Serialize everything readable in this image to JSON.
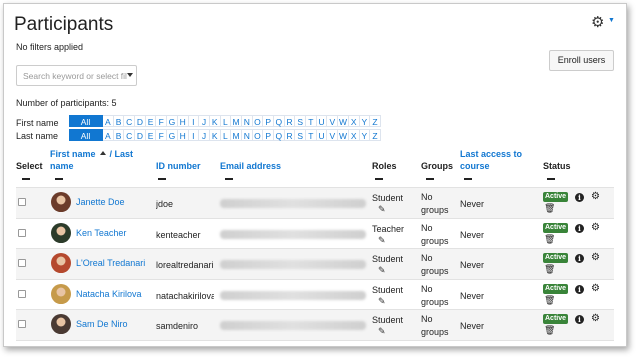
{
  "page": {
    "title": "Participants",
    "filters_text": "No filters applied",
    "enroll_label": "Enroll users",
    "search_placeholder": "Search keyword or select filter",
    "participants_count": "Number of participants: 5"
  },
  "initials_bar": {
    "firstname_label": "First name",
    "lastname_label": "Last name",
    "all_label": "All",
    "letters": [
      "A",
      "B",
      "C",
      "D",
      "E",
      "F",
      "G",
      "H",
      "I",
      "J",
      "K",
      "L",
      "M",
      "N",
      "O",
      "P",
      "Q",
      "R",
      "S",
      "T",
      "U",
      "V",
      "W",
      "X",
      "Y",
      "Z"
    ]
  },
  "table": {
    "headers": {
      "select": "Select",
      "first_name": "First name",
      "last_name": "/ Last",
      "name": "name",
      "id_number": "ID number",
      "email": "Email address",
      "roles": "Roles",
      "groups": "Groups",
      "last_access_1": "Last access to",
      "last_access_2": "course",
      "status": "Status"
    },
    "rows": [
      {
        "name": "Janette Doe",
        "id": "jdoe",
        "role": "Student",
        "groups_1": "No",
        "groups_2": "groups",
        "access": "Never",
        "status": "Active",
        "avatar_color": "#6b3b2a"
      },
      {
        "name": "Ken Teacher",
        "id": "kenteacher",
        "role": "Teacher",
        "groups_1": "No",
        "groups_2": "groups",
        "access": "Never",
        "status": "Active",
        "avatar_color": "#2c3b2a"
      },
      {
        "name": "L'Oreal Tredanari",
        "id": "lorealtredanari",
        "role": "Student",
        "groups_1": "No",
        "groups_2": "groups",
        "access": "Never",
        "status": "Active",
        "avatar_color": "#b5492e"
      },
      {
        "name": "Natacha Kirilova",
        "id": "natachakirilova",
        "role": "Student",
        "groups_1": "No",
        "groups_2": "groups",
        "access": "Never",
        "status": "Active",
        "avatar_color": "#c69a4a"
      },
      {
        "name": "Sam De Niro",
        "id": "samdeniro",
        "role": "Student",
        "groups_1": "No",
        "groups_2": "groups",
        "access": "Never",
        "status": "Active",
        "avatar_color": "#4a3a33"
      }
    ]
  }
}
